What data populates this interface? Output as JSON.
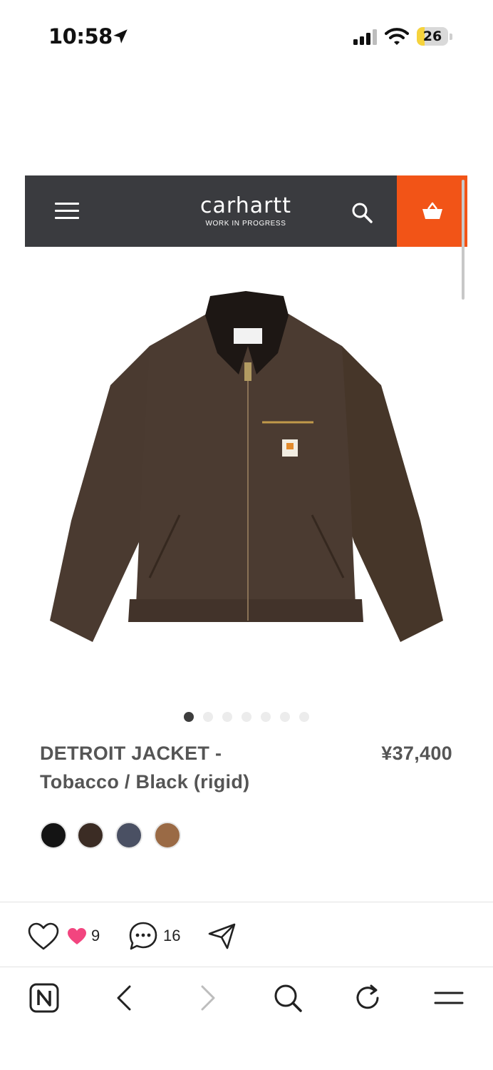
{
  "status_bar": {
    "time": "10:58",
    "battery_level": "26",
    "battery_fraction": 0.26,
    "icons": [
      "location-arrow-icon",
      "cellular-signal-icon",
      "wifi-icon",
      "battery-icon"
    ]
  },
  "site_header": {
    "brand": "carhartt",
    "tagline": "WORK IN PROGRESS",
    "icons": [
      "hamburger-menu-icon",
      "search-icon",
      "shopping-basket-icon"
    ],
    "colors": {
      "header_bg": "#3a3b3f",
      "cart_bg": "#f25417"
    }
  },
  "product": {
    "image": "jacket-photo",
    "carousel": {
      "count": 7,
      "active_index": 0
    },
    "title_line1": "DETROIT JACKET -",
    "title_line2": "Tobacco / Black (rigid)",
    "price": "¥37,400",
    "swatches": [
      {
        "name": "black",
        "color": "#141414"
      },
      {
        "name": "tobacco",
        "color": "#3b2c24"
      },
      {
        "name": "navy",
        "color": "#4a5063"
      },
      {
        "name": "hamilton-brown",
        "color": "#9a6a45"
      }
    ]
  },
  "social": {
    "likes": "9",
    "comments": "16",
    "icons": [
      "heart-outline-icon",
      "heart-filled-icon",
      "comment-bubble-icon",
      "share-paper-plane-icon"
    ]
  },
  "bottom_nav": {
    "icons": [
      "app-logo-n-icon",
      "back-arrow-icon",
      "forward-arrow-icon",
      "search-icon",
      "reload-icon",
      "menu-icon"
    ]
  }
}
